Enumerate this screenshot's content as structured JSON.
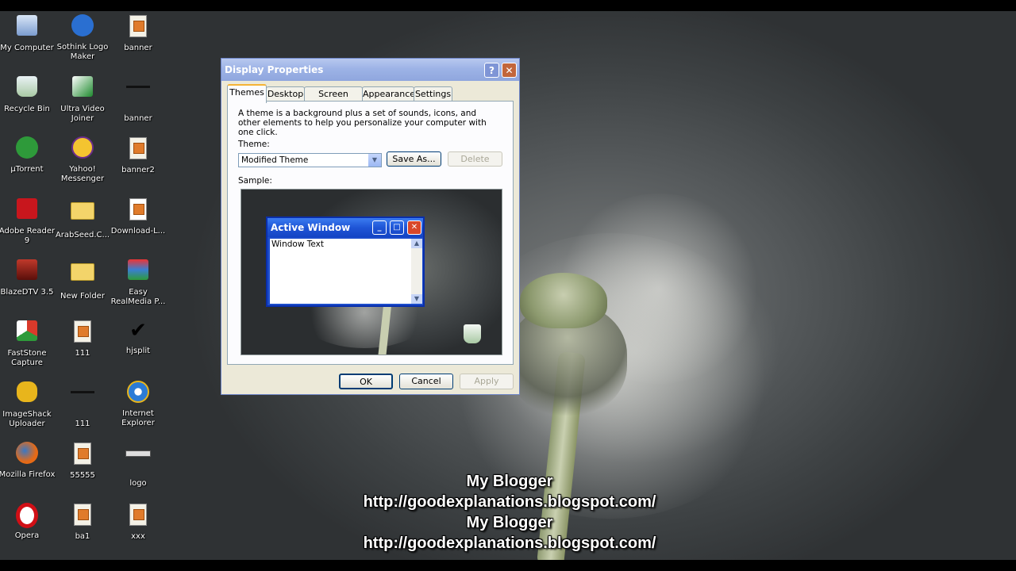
{
  "desktop": {
    "icons": [
      {
        "label": "My Computer"
      },
      {
        "label": "Sothink Logo Maker"
      },
      {
        "label": "banner"
      },
      {
        "label": "Recycle Bin"
      },
      {
        "label": "Ultra Video Joiner"
      },
      {
        "label": "banner"
      },
      {
        "label": "µTorrent"
      },
      {
        "label": "Yahoo! Messenger"
      },
      {
        "label": "banner2"
      },
      {
        "label": "Adobe Reader 9"
      },
      {
        "label": "ArabSeed.C..."
      },
      {
        "label": "Download-L..."
      },
      {
        "label": "BlazeDTV 3.5"
      },
      {
        "label": "New Folder"
      },
      {
        "label": "Easy RealMedia P..."
      },
      {
        "label": "FastStone Capture"
      },
      {
        "label": "111"
      },
      {
        "label": "hjsplit"
      },
      {
        "label": "ImageShack Uploader"
      },
      {
        "label": "111"
      },
      {
        "label": "Internet Explorer"
      },
      {
        "label": "Mozilla Firefox"
      },
      {
        "label": "55555"
      },
      {
        "label": "logo"
      },
      {
        "label": "Opera"
      },
      {
        "label": "ba1"
      },
      {
        "label": "xxx"
      }
    ]
  },
  "dialog": {
    "title": "Display Properties",
    "help_glyph": "?",
    "close_glyph": "✕",
    "tabs": [
      "Themes",
      "Desktop",
      "Screen Saver",
      "Appearance",
      "Settings"
    ],
    "description": "A theme is a background plus a set of sounds, icons, and other elements to help you personalize your computer with one click.",
    "theme_label": "Theme:",
    "theme_value": "Modified Theme",
    "save_as_label": "Save As...",
    "delete_label": "Delete",
    "sample_label": "Sample:",
    "preview": {
      "window_title": "Active Window",
      "window_text": "Window Text"
    },
    "ok_label": "OK",
    "cancel_label": "Cancel",
    "apply_label": "Apply"
  },
  "watermark": {
    "line1": "My Blogger",
    "line2": "http://goodexplanations.blogspot.com/",
    "line3": "My Blogger",
    "line4": "http://goodexplanations.blogspot.com/"
  }
}
